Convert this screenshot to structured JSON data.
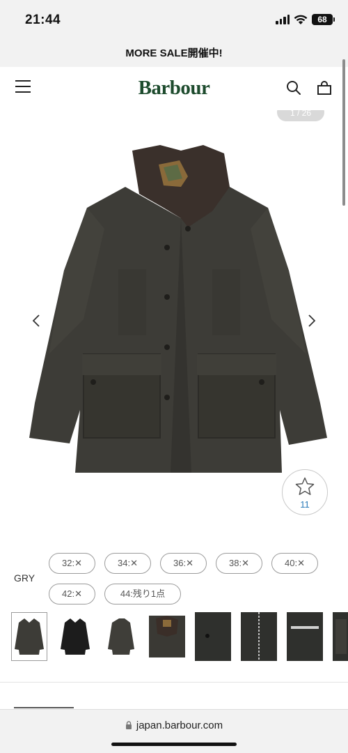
{
  "status_bar": {
    "time": "21:44",
    "battery": "68",
    "icons": [
      "signal-icon",
      "wifi-icon",
      "battery-icon"
    ]
  },
  "promo": {
    "text": "MORE SALE開催中!"
  },
  "header": {
    "logo": "Barbour",
    "logo_color": "#1d4b2d",
    "icons": [
      "menu-icon",
      "search-icon",
      "bag-icon"
    ]
  },
  "gallery": {
    "counter": "1 / 26",
    "favorite_count": "11",
    "icons": [
      "chevron-left-icon",
      "chevron-right-icon",
      "star-icon"
    ]
  },
  "product": {
    "color": "GRY",
    "sizes": [
      {
        "label": "32:✕"
      },
      {
        "label": "34:✕"
      },
      {
        "label": "36:✕"
      },
      {
        "label": "38:✕"
      },
      {
        "label": "40:✕"
      },
      {
        "label": "42:✕"
      },
      {
        "label": "44:残り1点"
      }
    ],
    "thumbnails": [
      {
        "name": "gray-jacket-front",
        "selected": true
      },
      {
        "name": "black-jacket-front"
      },
      {
        "name": "gray-jacket-side"
      },
      {
        "name": "collar-detail"
      },
      {
        "name": "button-detail"
      },
      {
        "name": "zipper-detail"
      },
      {
        "name": "pocket-detail"
      },
      {
        "name": "sleeve-detail"
      }
    ]
  },
  "browser": {
    "url": "japan.barbour.com"
  }
}
